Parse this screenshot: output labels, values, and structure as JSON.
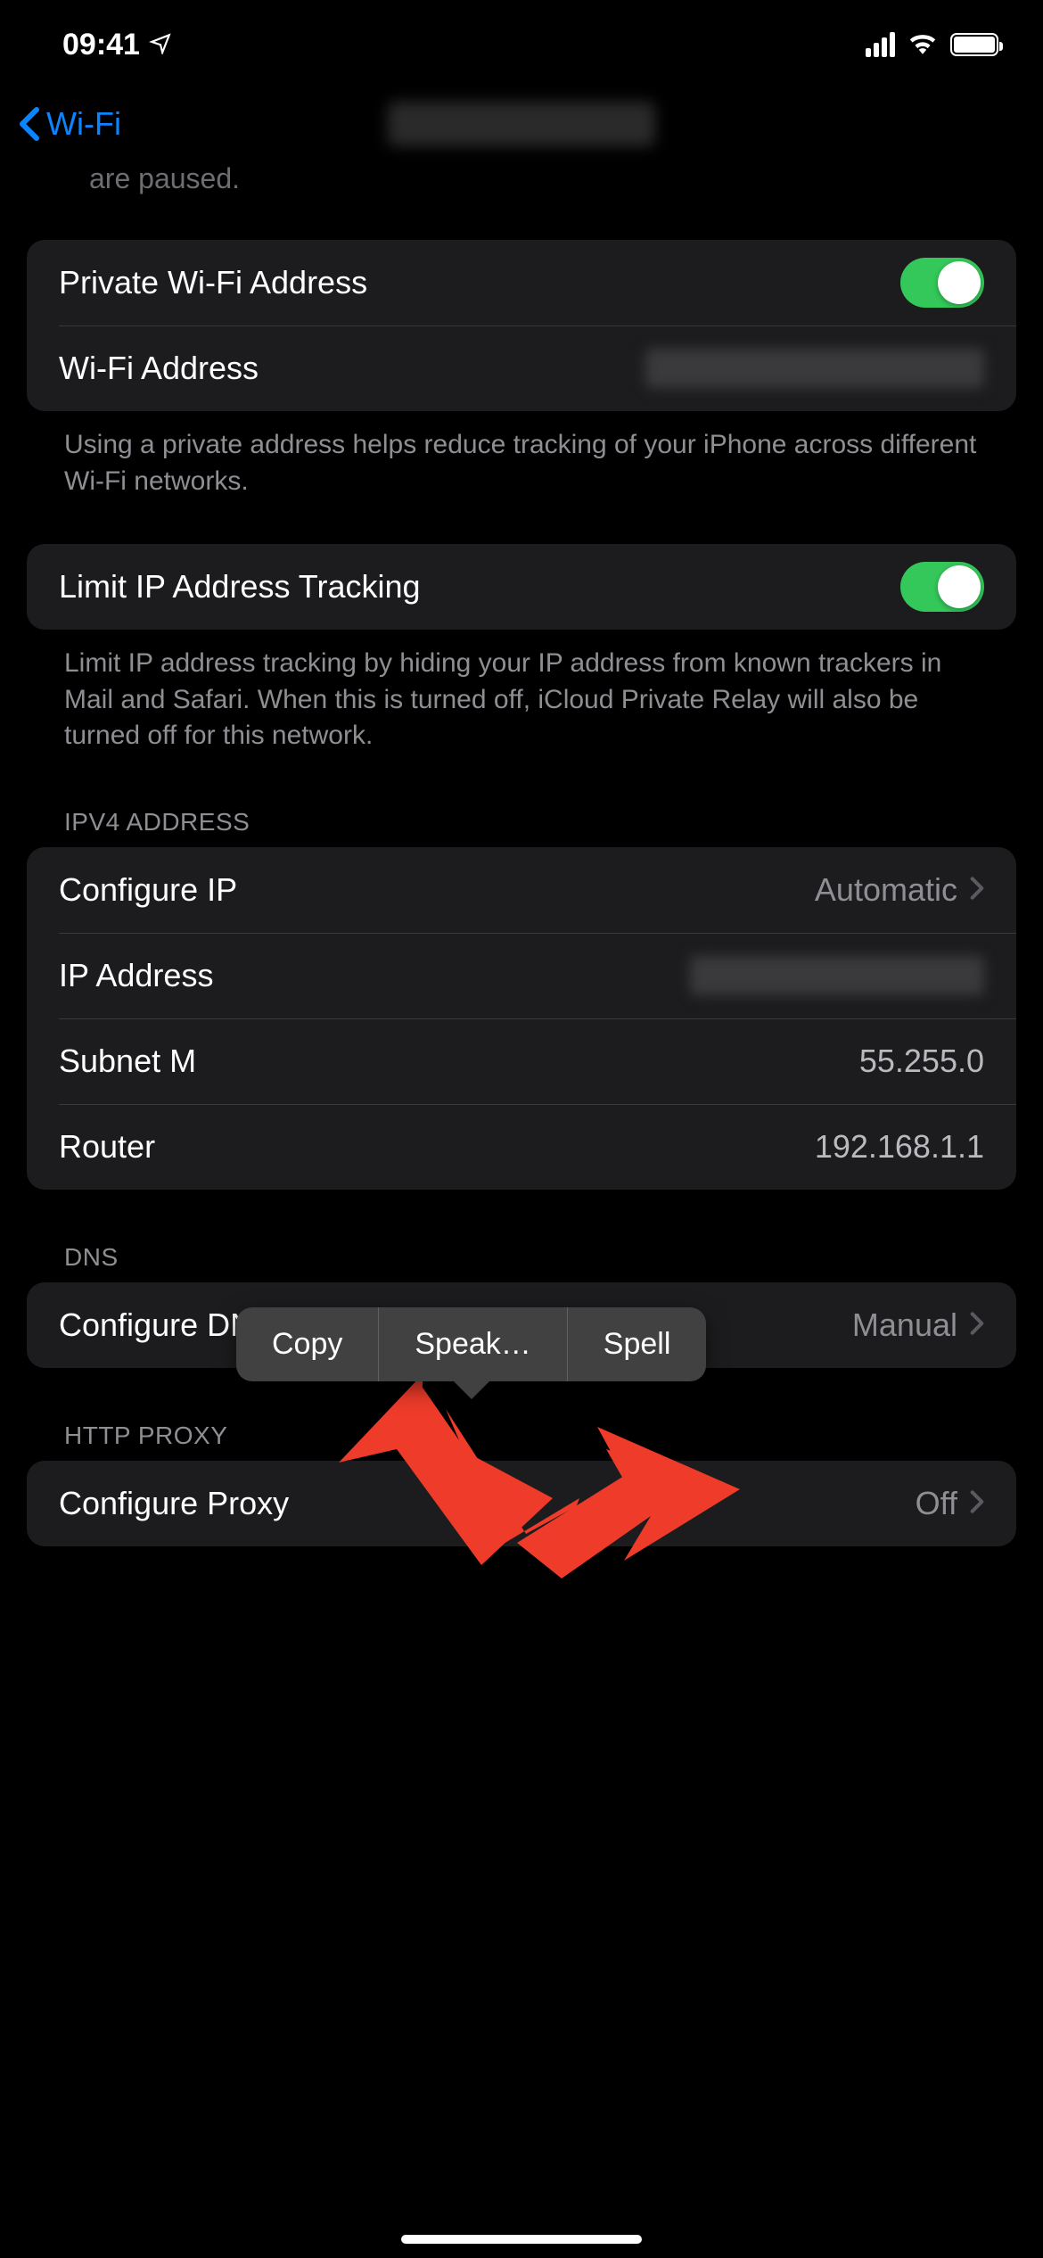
{
  "status": {
    "time": "09:41"
  },
  "nav": {
    "back_label": "Wi-Fi"
  },
  "cutoff_text": "are paused.",
  "group1": {
    "private_wifi_label": "Private Wi-Fi Address",
    "wifi_address_label": "Wi-Fi Address",
    "footer": "Using a private address helps reduce tracking of your iPhone across different Wi-Fi networks."
  },
  "group2": {
    "limit_tracking_label": "Limit IP Address Tracking",
    "footer": "Limit IP address tracking by hiding your IP address from known trackers in Mail and Safari. When this is turned off, iCloud Private Relay will also be turned off for this network."
  },
  "ipv4": {
    "header": "IPV4 ADDRESS",
    "configure_ip_label": "Configure IP",
    "configure_ip_value": "Automatic",
    "ip_address_label": "IP Address",
    "subnet_label": "Subnet Mask",
    "subnet_value_partial": "55.255.0",
    "router_label": "Router",
    "router_value": "192.168.1.1"
  },
  "dns": {
    "header": "DNS",
    "configure_label": "Configure DNS",
    "configure_value": "Manual"
  },
  "proxy": {
    "header": "HTTP PROXY",
    "configure_label": "Configure Proxy",
    "configure_value": "Off"
  },
  "popover": {
    "copy": "Copy",
    "speak": "Speak…",
    "spell": "Spell"
  }
}
